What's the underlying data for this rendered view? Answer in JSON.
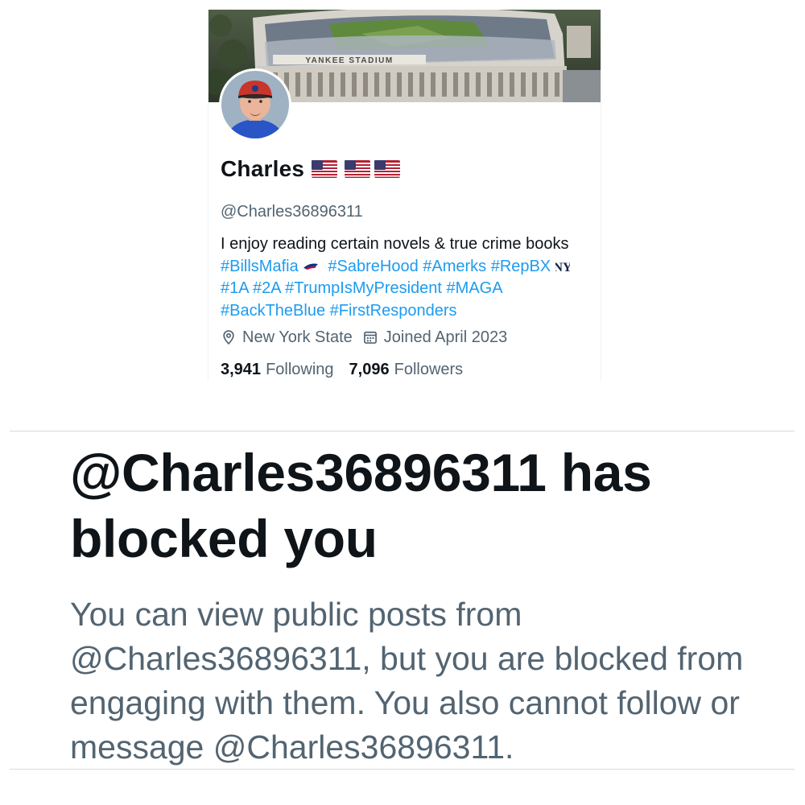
{
  "profile": {
    "display_name": "Charles",
    "handle": "@Charles36896311",
    "bio": {
      "text": "I enjoy reading certain novels & true crime books",
      "hashtags": {
        "bills_mafia": "#BillsMafia",
        "sabre_hood": "#SabreHood",
        "amerks": "#Amerks",
        "rep_bx": "#RepBX",
        "one_a": "#1A",
        "two_a": "#2A",
        "trump": "#TrumpIsMyPresident",
        "maga": "#MAGA",
        "back_the_blue": "#BackTheBlue",
        "first_responders": "#FirstResponders"
      }
    },
    "location": "New York State",
    "joined": "Joined April 2023",
    "following": {
      "count": "3,941",
      "label": "Following"
    },
    "followers": {
      "count": "7,096",
      "label": "Followers"
    },
    "banner_sign": "YANKEE STADIUM"
  },
  "notice": {
    "title": "@Charles36896311 has blocked you",
    "body": "You can view public posts from @Charles36896311, but you are blocked from engaging with them. You also cannot follow or message @Charles36896311."
  },
  "colors": {
    "text_primary": "#0f1419",
    "text_secondary": "#536471",
    "link": "#1d9bf0"
  },
  "icons": {
    "flags": "us-flag-icon",
    "bills": "bills-logo-icon",
    "yankees": "yankees-logo-icon",
    "location": "location-pin-icon",
    "calendar": "calendar-icon"
  }
}
